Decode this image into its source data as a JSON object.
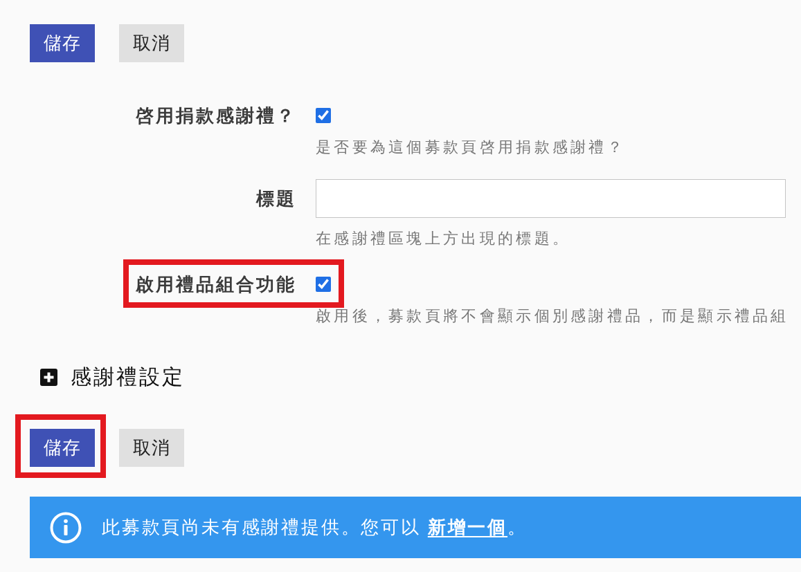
{
  "top_actions": {
    "buttons": [
      {
        "label": "儲存",
        "kind": "primary",
        "highlighted": false
      },
      {
        "label": "取消",
        "kind": "secondary",
        "highlighted": false
      }
    ]
  },
  "fields": [
    {
      "kind": "checkbox",
      "label": "啓用捐款感謝禮？",
      "checked": true,
      "help": "是否要為這個募款頁啓用捐款感謝禮？",
      "highlighted": false
    },
    {
      "kind": "text",
      "label": "標題",
      "help": "在感謝禮區塊上方出現的標題。",
      "highlighted": false
    },
    {
      "kind": "checkbox",
      "label": "啟用禮品組合功能",
      "checked": true,
      "help": "啟用後，募款頁將不會顯示個別感謝禮品，而是顯示禮品組",
      "highlighted": true
    }
  ],
  "section": {
    "title": "感謝禮設定",
    "expanded": false
  },
  "bottom_actions": {
    "buttons": [
      {
        "label": "儲存",
        "kind": "primary",
        "highlighted": true
      },
      {
        "label": "取消",
        "kind": "secondary",
        "highlighted": false
      }
    ]
  },
  "info": {
    "text": "此募款頁尚未有感謝禮提供。您可以 ",
    "link": "新增一個",
    "text_after": "。"
  }
}
